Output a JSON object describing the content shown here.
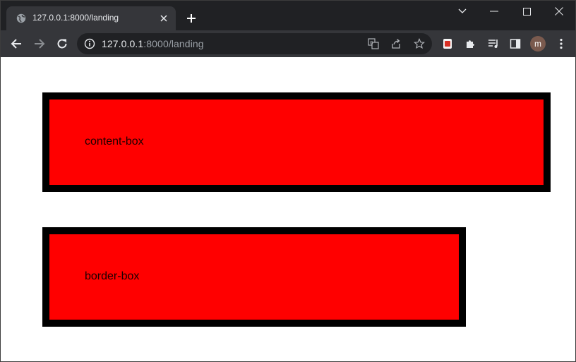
{
  "browser": {
    "tab": {
      "title": "127.0.0.1:8000/landing",
      "favicon": "globe-icon"
    },
    "address": {
      "host": "127.0.0.1",
      "rest": ":8000/landing"
    },
    "profile_initial": "m",
    "colors": {
      "tabstrip": "#202124",
      "toolbar": "#35363a",
      "omnibox": "#202124",
      "text": "#e8eaed"
    }
  },
  "page": {
    "boxes": [
      {
        "label": "content-box"
      },
      {
        "label": "border-box"
      }
    ],
    "colors": {
      "fill": "#ff0000",
      "border": "#000000"
    }
  }
}
